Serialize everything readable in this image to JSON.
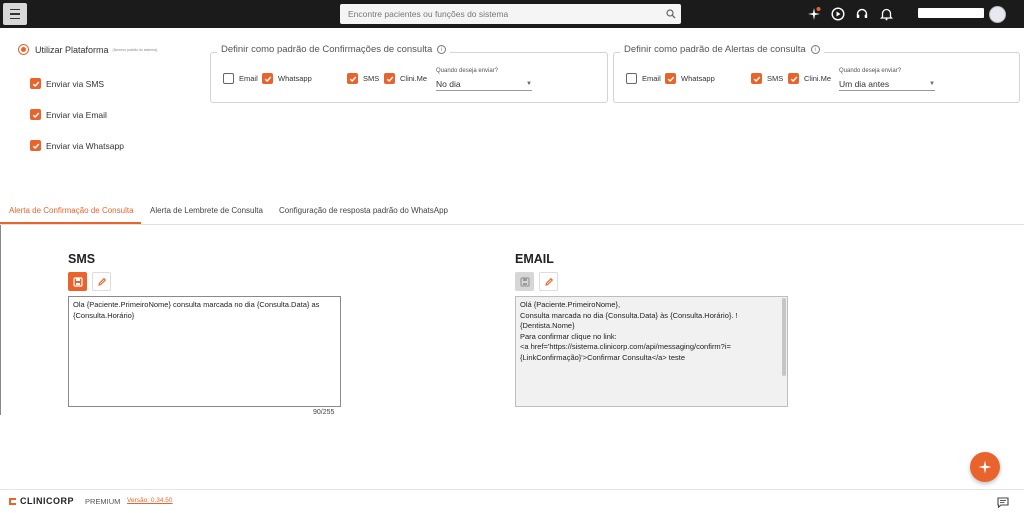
{
  "colors": {
    "accent": "#e8642c",
    "topbar": "#1b1b1b"
  },
  "topbar": {
    "search_placeholder": "Encontre pacientes ou funções do sistema",
    "icons": [
      "menu-icon",
      "search-icon",
      "sparkle-notification-icon",
      "play-circle-icon",
      "headset-icon",
      "bell-icon"
    ]
  },
  "left_options": {
    "platform_label": "Utilizar Plataforma",
    "platform_sub": "(Número padrão do sistema)",
    "sms_label": "Enviar via SMS",
    "email_label": "Enviar via Email",
    "whatsapp_label": "Enviar via Whatsapp"
  },
  "confirmations_group": {
    "title": "Definir como padrão de Confirmações de consulta",
    "email": "Email",
    "whatsapp": "Whatsapp",
    "sms": "SMS",
    "clinime": "Clini.Me",
    "when_label": "Quando deseja enviar?",
    "when_value": "No dia"
  },
  "alerts_group": {
    "title": "Definir como padrão de Alertas de consulta",
    "email": "Email",
    "whatsapp": "Whatsapp",
    "sms": "SMS",
    "clinime": "Clini.Me",
    "when_label": "Quando deseja enviar?",
    "when_value": "Um dia antes"
  },
  "tabs": [
    {
      "label": "Alerta de Confirmação de Consulta"
    },
    {
      "label": "Alerta de Lembrete de Consulta"
    },
    {
      "label": "Configuração de resposta padrão do WhatsApp"
    }
  ],
  "sms": {
    "title": "SMS",
    "text": "Ola {Paciente.PrimeiroNome} consulta marcada no dia {Consulta.Data} as {Consulta.Horário}",
    "counter": "90/255"
  },
  "email": {
    "title": "EMAIL",
    "lines": [
      "Olá {Paciente.PrimeiroNome},",
      "",
      "Consulta marcada no dia {Consulta.Data} às {Consulta.Horário}. ! {Dentista.Nome}",
      "",
      "Para confirmar clique no link:",
      "",
      "<a href='https://sistema.clinicorp.com/api/messaging/confirm?i={LinkConfirmação}'>Confirmar Consulta</a> teste"
    ]
  },
  "footer": {
    "brand": "CLINICORP",
    "plan": "PREMIUM",
    "version": "Versão: 0.34.50"
  }
}
